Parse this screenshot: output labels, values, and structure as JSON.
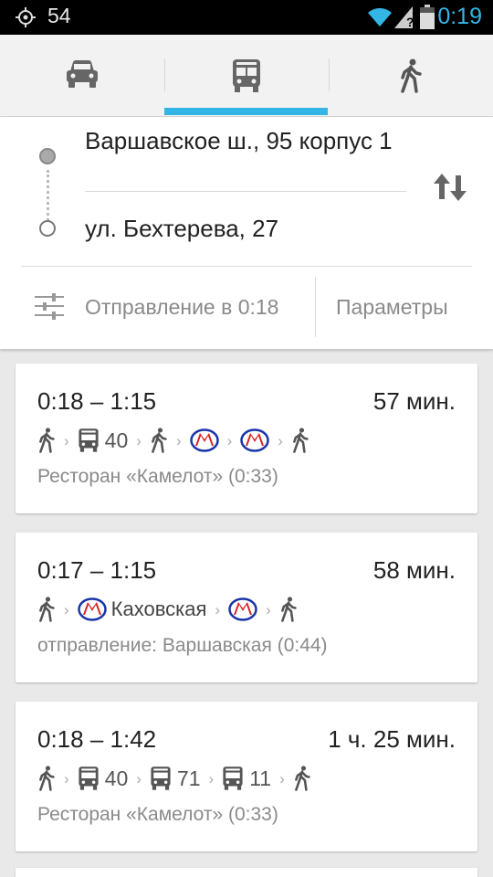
{
  "status_bar": {
    "notification_count": "54",
    "time": "0:19",
    "icons": [
      "gps-icon",
      "wifi-icon",
      "signal-unknown-icon",
      "battery-icon"
    ]
  },
  "mode_tabs": [
    {
      "icon": "car-icon",
      "selected": false
    },
    {
      "icon": "transit-bus-icon",
      "selected": true
    },
    {
      "icon": "walking-icon",
      "selected": false
    }
  ],
  "route": {
    "from": "Варшавское ш., 95 корпус 1",
    "to": "ул. Бехтерева, 27",
    "depart_label": "Отправление в 0:18",
    "params_label": "Параметры"
  },
  "results": [
    {
      "times": "0:18 – 1:15",
      "duration": "57 мин.",
      "steps": [
        {
          "type": "walk"
        },
        {
          "type": "bus",
          "number": "40"
        },
        {
          "type": "walk"
        },
        {
          "type": "metro"
        },
        {
          "type": "metro"
        },
        {
          "type": "walk"
        }
      ],
      "note": "Ресторан «Камелот» (0:33)"
    },
    {
      "times": "0:17 – 1:15",
      "duration": "58 мин.",
      "steps": [
        {
          "type": "walk"
        },
        {
          "type": "metro",
          "station": "Каховская"
        },
        {
          "type": "metro"
        },
        {
          "type": "walk"
        }
      ],
      "note": "отправление: Варшавская (0:44)"
    },
    {
      "times": "0:18 – 1:42",
      "duration": "1 ч. 25 мин.",
      "steps": [
        {
          "type": "walk"
        },
        {
          "type": "bus",
          "number": "40"
        },
        {
          "type": "bus",
          "number": "71"
        },
        {
          "type": "bus",
          "number": "11"
        },
        {
          "type": "walk"
        }
      ],
      "note": "Ресторан «Камелот» (0:33)"
    }
  ],
  "colors": {
    "accent": "#33b5e5",
    "metro_red": "#d81e1e",
    "metro_blue": "#1a35a8"
  }
}
